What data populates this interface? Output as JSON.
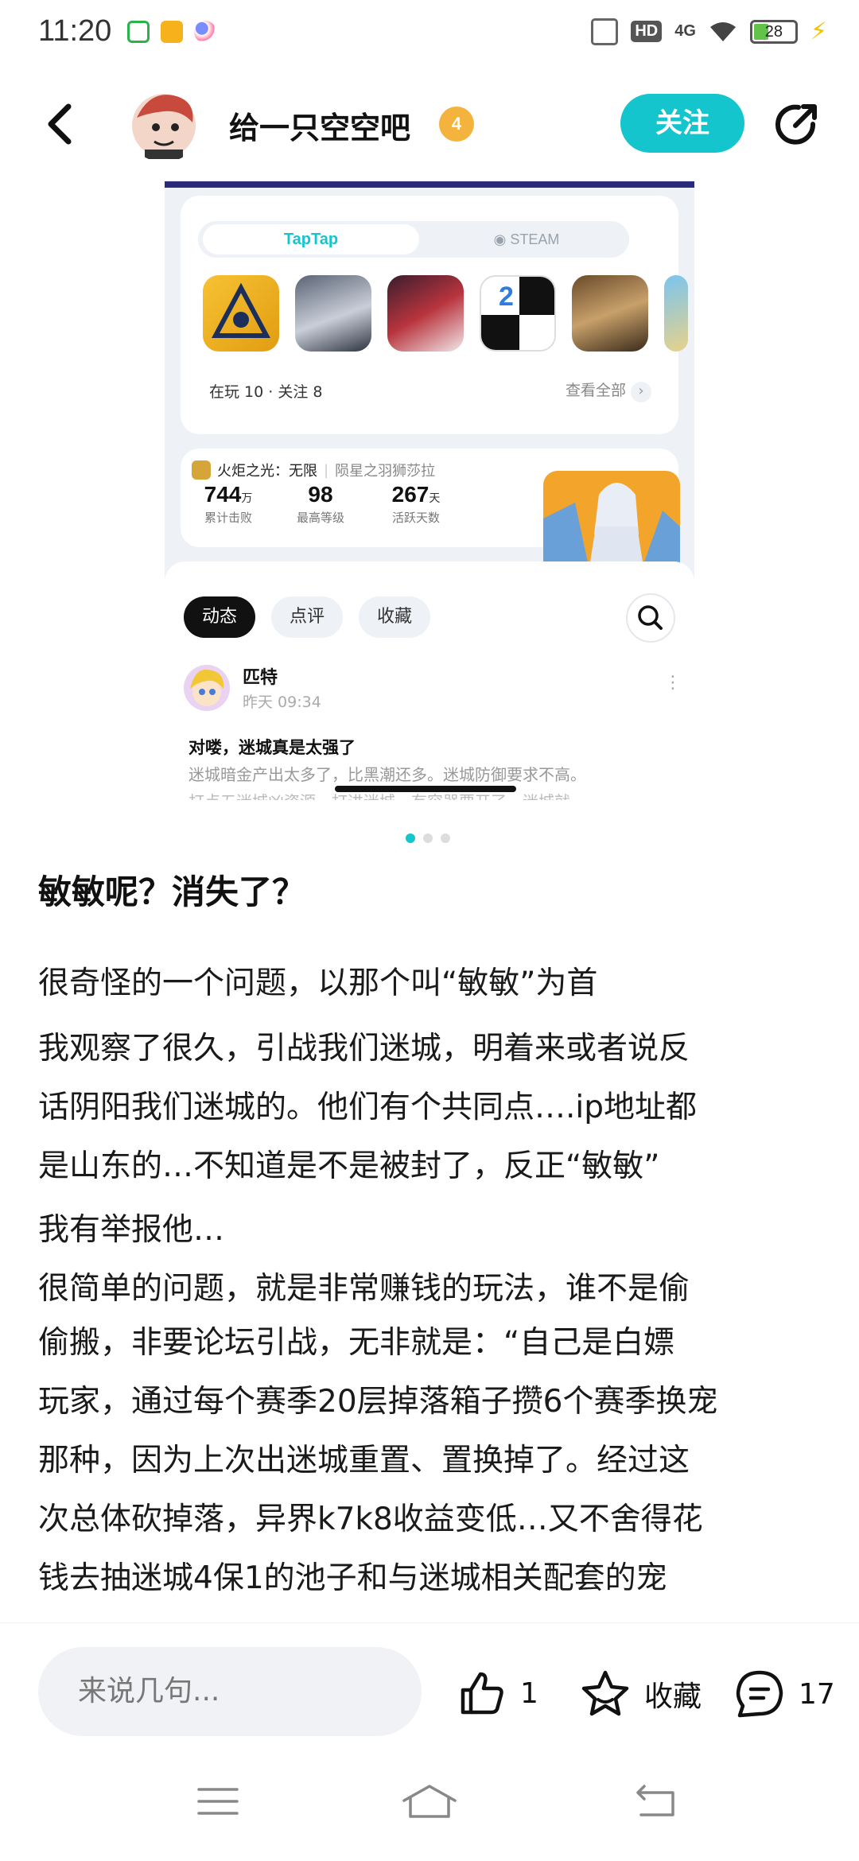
{
  "status_bar": {
    "time": "11:20",
    "hd_label": "HD",
    "network_label": "4G",
    "battery_level": "28",
    "icons": [
      "messages-icon",
      "mail-icon",
      "app-icon",
      "vibrate-icon",
      "wifi-icon",
      "battery-icon",
      "charging-icon"
    ]
  },
  "header": {
    "username": "给一只空空吧",
    "level_badge": "4",
    "follow_label": "关注",
    "icons": [
      "back-arrow-icon",
      "share-icon"
    ],
    "accent_color": "#15c5ce"
  },
  "embedded_screenshot": {
    "platform_tabs": [
      "TapTap",
      "STEAM"
    ],
    "game_icon_count": 6,
    "playing_summary": "在玩 10 · 关注 8",
    "view_all": "查看全部",
    "game_title": "火炬之光：无限",
    "character_name": "陨星之羽狮莎拉",
    "stats": [
      {
        "value": "744",
        "unit": "万",
        "label": "累计击败"
      },
      {
        "value": "98",
        "unit": "",
        "label": "最高等级"
      },
      {
        "value": "267",
        "unit": "天",
        "label": "活跃天数"
      }
    ],
    "feed_tabs": [
      "动态",
      "点评",
      "收藏"
    ],
    "post": {
      "author": "匹特",
      "time": "昨天 09:34",
      "more": "⋮",
      "title": "对喽，迷城真是太强了",
      "excerpt": "迷城暗金产出太多了，比黑潮还多。迷城防御要求不高。",
      "excerpt_line2": "打点五迷城凶资源，打进迷城，有容器要开了，迷城就"
    }
  },
  "pager": {
    "count": 3,
    "active": 0
  },
  "article": {
    "title": "敏敏呢？消失了？",
    "paragraphs": [
      "很奇怪的一个问题，以那个叫“敏敏”为首",
      "我观察了很久，引战我们迷城，明着来或者说反",
      "话阴阳我们迷城的。他们有个共同点….ip地址都",
      "是山东的…不知道是不是被封了，反正“敏敏”",
      "我有举报他…",
      "很简单的问题，就是非常赚钱的玩法，谁不是偷",
      "偷搬，非要论坛引战，无非就是：“自己是白嫖",
      "玩家，通过每个赛季20层掉落箱子攒6个赛季换宠",
      "那种，因为上次出迷城重置、置换掉了。经过这",
      "次总体砍掉落，异界k7k8收益变低…又不舍得花",
      "钱去抽迷城4保1的池子和与迷城相关配套的宠"
    ]
  },
  "bottom_bar": {
    "comment_placeholder": "来说几句...",
    "like_count": "1",
    "favorite_label": "收藏",
    "comment_count": "17"
  },
  "system_nav": {
    "icons": [
      "menu-icon",
      "home-icon",
      "back-icon"
    ]
  }
}
